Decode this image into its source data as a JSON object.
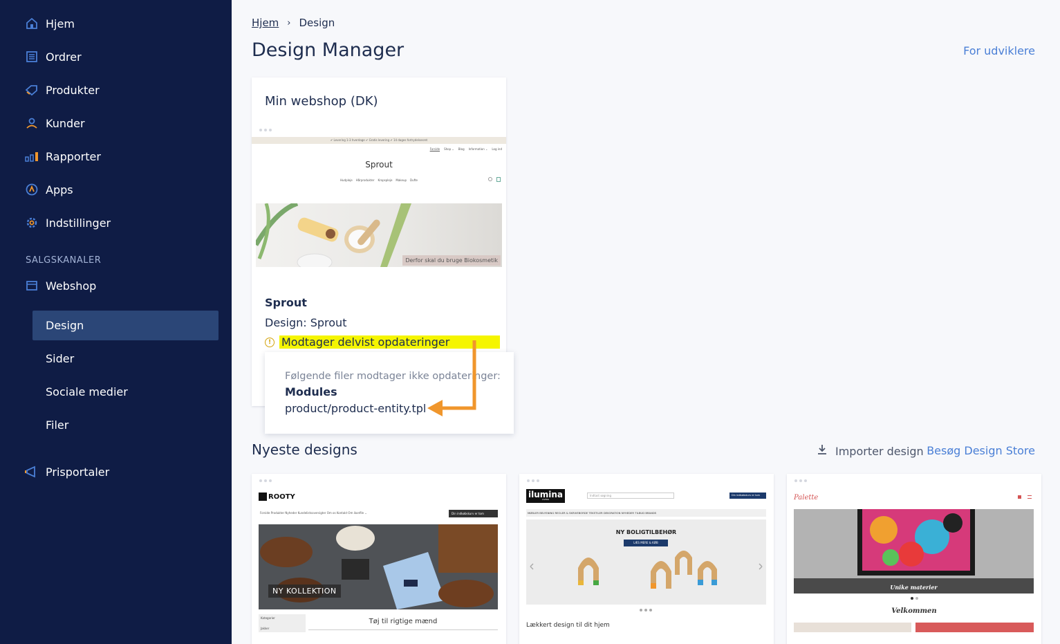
{
  "sidebar": {
    "items": [
      {
        "label": "Hjem",
        "icon": "home-icon"
      },
      {
        "label": "Ordrer",
        "icon": "orders-icon"
      },
      {
        "label": "Produkter",
        "icon": "tag-icon"
      },
      {
        "label": "Kunder",
        "icon": "user-icon"
      },
      {
        "label": "Rapporter",
        "icon": "chart-icon"
      },
      {
        "label": "Apps",
        "icon": "apps-icon"
      },
      {
        "label": "Indstillinger",
        "icon": "gear-icon"
      }
    ],
    "section_label": "SALGSKANALER",
    "webshop": {
      "label": "Webshop",
      "icon": "store-icon"
    },
    "sub_items": [
      "Design",
      "Sider",
      "Sociale medier",
      "Filer"
    ],
    "prisportaler": {
      "label": "Prisportaler",
      "icon": "megaphone-icon"
    }
  },
  "breadcrumb": {
    "home": "Hjem",
    "separator": "›",
    "current": "Design"
  },
  "page_title": "Design Manager",
  "dev_link": "For udviklere",
  "main_card": {
    "title": "Min webshop (DK)",
    "preview": {
      "topbar": "✔ Levering 1-3 hverdage  ✔ Gratis levering  ✔ 14 dages fortrydelsesret",
      "nav": [
        "Forside",
        "Shop ⌄",
        "Blog",
        "Information ⌄",
        "Log ind"
      ],
      "logo": "Sprout",
      "categories": [
        "Hudpleje",
        "Hårprodukter",
        "Kropspleje",
        "Makeup",
        "Dufte"
      ],
      "banner_caption": "Derfor skal du bruge Biokosmetik"
    },
    "theme_name": "Sprout",
    "design_line": "Design: Sprout",
    "status": "Modtager delvist opdateringer"
  },
  "popover": {
    "intro": "Følgende filer modtager ikke opdateringer:",
    "heading": "Modules",
    "file": "product/product-entity.tpl"
  },
  "newest": {
    "title": "Nyeste designs",
    "import_label": "Importer design",
    "store_label": "Besøg Design Store"
  },
  "thumbs": {
    "rooty": {
      "logo": "ROOTY",
      "cart": "Din indkøbskurv er tom",
      "badge": "NY KOLLEKTION",
      "sidebar_head": "Kategorier",
      "sidebar_item": "Jakker",
      "tagline": "Tøj til rigtige mænd",
      "nav": "Forside  Produkter  Nyheder  Kundelistsoversigter  Om os  Kontakt  Om ikonfile ⌄"
    },
    "ilumina": {
      "logo": "ilumina",
      "sublogo": "LIVING",
      "search_placeholder": "Indtast søgning",
      "cart": "Din indkøbskurv er tom",
      "nav": "MØBLER  BELYSNING  REOLER & SKRIVEBORDE  TEKSTILER  DEKORATION  NYHEDER  TILBUD  BRANDS",
      "headline": "NY BOLIGTILBEHØR",
      "cta": "LÆS MERE & KØB",
      "tagline": "Lækkert design til dit hjem"
    },
    "palette": {
      "logo": "Palette",
      "caption": "Unike materier",
      "tagline": "Velkommen"
    }
  },
  "colors": {
    "sidebar": "#0f1c45",
    "active": "#2b4677",
    "accent": "#4a7fd6",
    "highlight": "#f5f500",
    "arrow": "#f0962c"
  }
}
